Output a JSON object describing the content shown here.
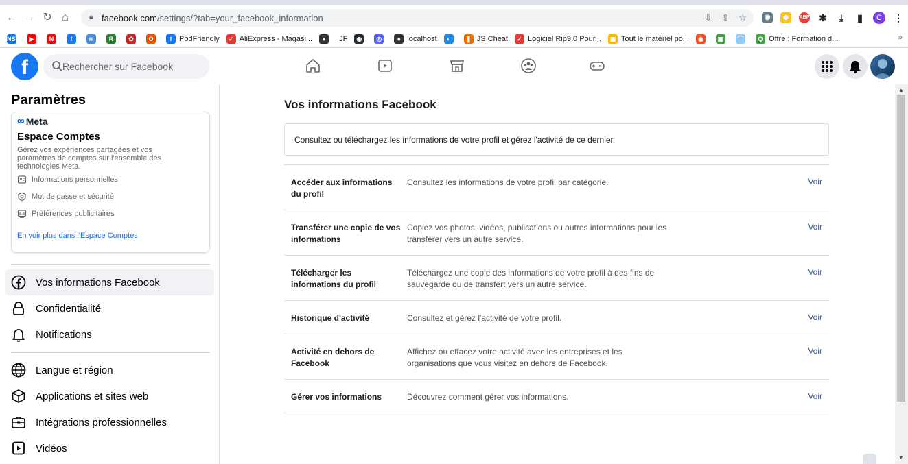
{
  "browser": {
    "url_domain": "facebook.com",
    "url_path": "/settings/?tab=your_facebook_information",
    "profile_initial": "C",
    "bookmarks": [
      {
        "label": "",
        "color": "#1a73e8",
        "glyph": "NST"
      },
      {
        "label": "",
        "color": "#ff0000",
        "glyph": "▶"
      },
      {
        "label": "",
        "color": "#e50914",
        "glyph": "N"
      },
      {
        "label": "",
        "color": "#1877f2",
        "glyph": "f"
      },
      {
        "label": "",
        "color": "#4a90d9",
        "glyph": "≋"
      },
      {
        "label": "",
        "color": "#2e7d32",
        "glyph": "R"
      },
      {
        "label": "",
        "color": "#c62828",
        "glyph": "✿"
      },
      {
        "label": "",
        "color": "#e65100",
        "glyph": "O"
      },
      {
        "label": "PodFriendly",
        "color": "#1877f2",
        "glyph": "f"
      },
      {
        "label": "AliExpress - Magasi...",
        "color": "#e53935",
        "glyph": "✓"
      },
      {
        "label": "",
        "color": "#333333",
        "glyph": "●"
      },
      {
        "label": "JF",
        "color": "#ffffff",
        "glyph": ""
      },
      {
        "label": "",
        "color": "#24292e",
        "glyph": "◉"
      },
      {
        "label": "",
        "color": "#5865f2",
        "glyph": "◎"
      },
      {
        "label": "localhost",
        "color": "#333333",
        "glyph": "●"
      },
      {
        "label": "",
        "color": "#1e88e5",
        "glyph": "◐"
      },
      {
        "label": "JS Cheat",
        "color": "#ef6c00",
        "glyph": "❚"
      },
      {
        "label": "Logiciel Rip9.0 Pour...",
        "color": "#e53935",
        "glyph": "✓"
      },
      {
        "label": "Tout le matériel po...",
        "color": "#ffb300",
        "glyph": "▦"
      },
      {
        "label": "",
        "color": "#f4511e",
        "glyph": "◉"
      },
      {
        "label": "",
        "color": "#43a047",
        "glyph": "▣"
      },
      {
        "label": "",
        "color": "#90caf9",
        "glyph": "⌒"
      },
      {
        "label": "Offre : Formation d...",
        "color": "#43a047",
        "glyph": "Q"
      }
    ],
    "bookmarks_more": "»"
  },
  "facebook": {
    "search_placeholder": "Rechercher sur Facebook"
  },
  "sidebar": {
    "title": "Paramètres",
    "accounts_center": {
      "brand": "Meta",
      "heading": "Espace Comptes",
      "description": "Gérez vos expériences partagées et vos paramètres de comptes sur l'ensemble des technologies Meta.",
      "items": [
        {
          "label": "Informations personnelles",
          "icon": "id-card-icon"
        },
        {
          "label": "Mot de passe et sécurité",
          "icon": "shield-icon"
        },
        {
          "label": "Préférences publicitaires",
          "icon": "monitor-icon"
        }
      ],
      "link": "En voir plus dans l'Espace Comptes"
    },
    "items": [
      {
        "label": "Vos informations Facebook",
        "icon": "facebook-circle-icon",
        "active": true
      },
      {
        "label": "Confidentialité",
        "icon": "lock-icon"
      },
      {
        "label": "Notifications",
        "icon": "bell-icon"
      },
      {
        "label": "Langue et région",
        "icon": "globe-icon"
      },
      {
        "label": "Applications et sites web",
        "icon": "cube-icon"
      },
      {
        "label": "Intégrations professionnelles",
        "icon": "briefcase-icon"
      },
      {
        "label": "Vidéos",
        "icon": "video-icon"
      }
    ]
  },
  "main": {
    "title": "Vos informations Facebook",
    "intro": "Consultez ou téléchargez les informations de votre profil et gérez l'activité de ce dernier.",
    "rows": [
      {
        "name": "Accéder aux informations du profil",
        "desc": "Consultez les informations de votre profil par catégorie.",
        "action": "Voir"
      },
      {
        "name": "Transférer une copie de vos informations",
        "desc": "Copiez vos photos, vidéos, publications ou autres informations pour les transférer vers un autre service.",
        "action": "Voir"
      },
      {
        "name": "Télécharger les informations du profil",
        "desc": "Téléchargez une copie des informations de votre profil à des fins de sauvegarde ou de transfert vers un autre service.",
        "action": "Voir"
      },
      {
        "name": "Historique d'activité",
        "desc": "Consultez et gérez l'activité de votre profil.",
        "action": "Voir"
      },
      {
        "name": "Activité en dehors de Facebook",
        "desc": "Affichez ou effacez votre activité avec les entreprises et les organisations que vous visitez en dehors de Facebook.",
        "action": "Voir"
      },
      {
        "name": "Gérer vos informations",
        "desc": "Découvrez comment gérer vos informations.",
        "action": "Voir"
      }
    ]
  }
}
